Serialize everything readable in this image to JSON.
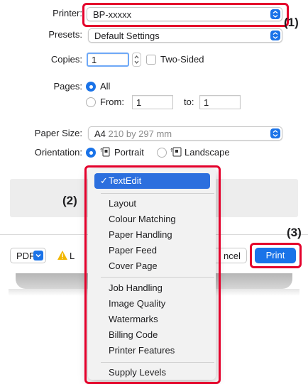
{
  "printer": {
    "label": "Printer:",
    "value": "BP-xxxxx"
  },
  "presets": {
    "label": "Presets:",
    "value": "Default Settings"
  },
  "copies": {
    "label": "Copies:",
    "value": "1",
    "two_sided_label": "Two-Sided"
  },
  "pages": {
    "label": "Pages:",
    "all_label": "All",
    "from_label": "From:",
    "from_value": "1",
    "to_label": "to:",
    "to_value": "1"
  },
  "paper_size": {
    "label": "Paper Size:",
    "value": "A4",
    "dimensions": "210 by 297 mm"
  },
  "orientation": {
    "label": "Orientation:",
    "portrait_label": "Portrait",
    "landscape_label": "Landscape"
  },
  "menu": {
    "selected": "TextEdit",
    "check": "✓",
    "items": [
      "Layout",
      "Colour Matching",
      "Paper Handling",
      "Paper Feed",
      "Cover Page",
      "Job Handling",
      "Image Quality",
      "Watermarks",
      "Billing Code",
      "Printer Features",
      "Supply Levels"
    ]
  },
  "bottom_bar": {
    "pdf_label": "PDF",
    "partial_left": "L",
    "cancel_partial": "ncel",
    "print_label": "Print"
  },
  "callouts": {
    "c1": "(1)",
    "c2": "(2)",
    "c3": "(3)"
  },
  "colors": {
    "accent": "#1a73e8",
    "highlight": "#e4002b",
    "selection": "#2c6fde"
  },
  "icons": {
    "warning": "warning-icon",
    "chevron": "chevron-updown-icon",
    "portrait": "portrait-orientation-icon",
    "landscape": "landscape-orientation-icon"
  }
}
